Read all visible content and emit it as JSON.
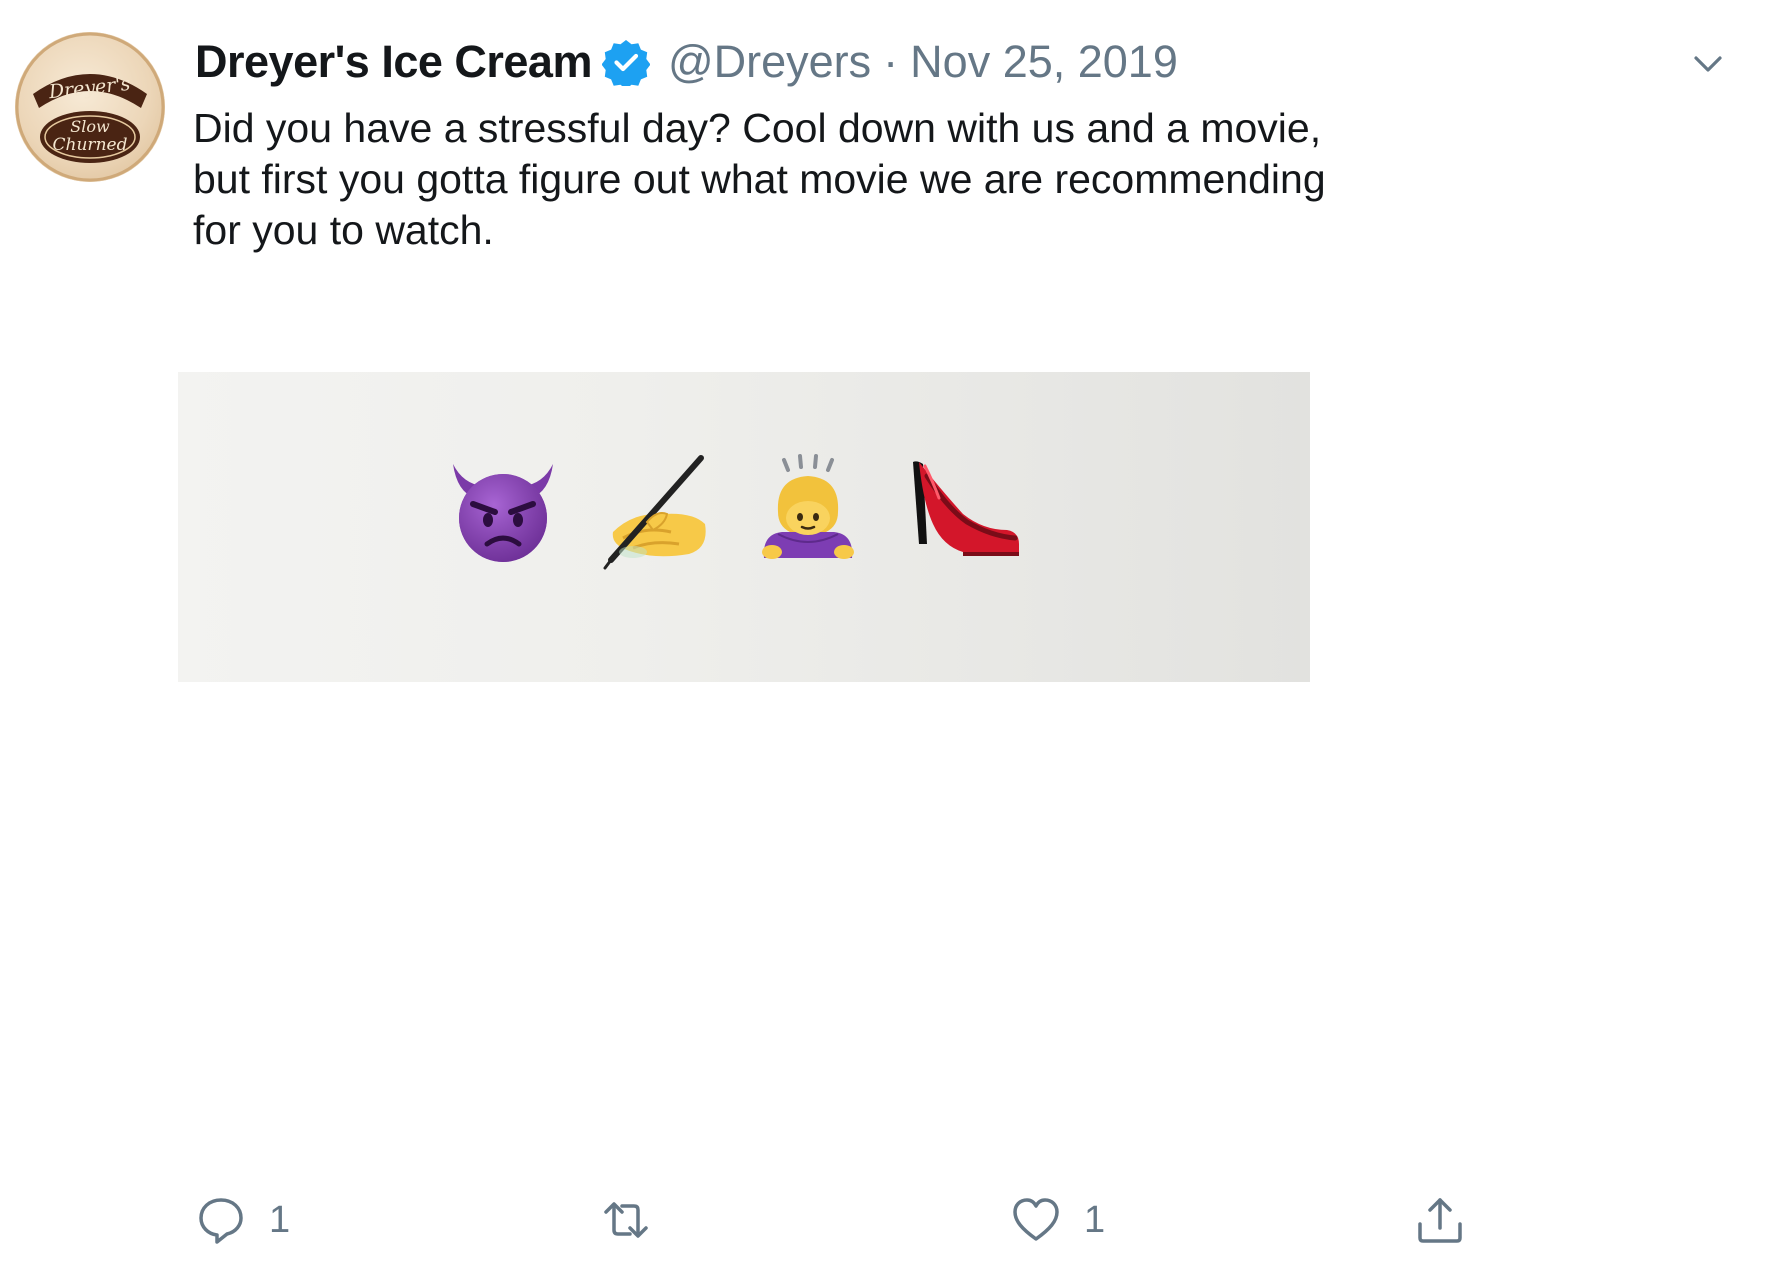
{
  "tweet": {
    "author": {
      "display_name": "Dreyer's Ice Cream",
      "handle": "@Dreyers",
      "verified": true,
      "avatar_icon": "dreyers-slow-churned-logo",
      "avatar_text_top": "Dreyer's",
      "avatar_text_bottom": "Slow Churned"
    },
    "separator": "·",
    "date": "Nov 25, 2019",
    "text": "Did you have a stressful day? Cool down with us and a movie, but first you gotta figure out what movie we are recommending for you to watch.",
    "media": {
      "emojis": [
        "angry-devil-face",
        "writing-hand",
        "person-bowing",
        "high-heeled-shoe"
      ]
    },
    "actions": {
      "reply_count": "1",
      "retweet_count": "",
      "like_count": "1",
      "share_count": ""
    }
  },
  "colors": {
    "verified_blue": "#1da1f2",
    "muted_gray": "#657786",
    "text_dark": "#14171a"
  }
}
